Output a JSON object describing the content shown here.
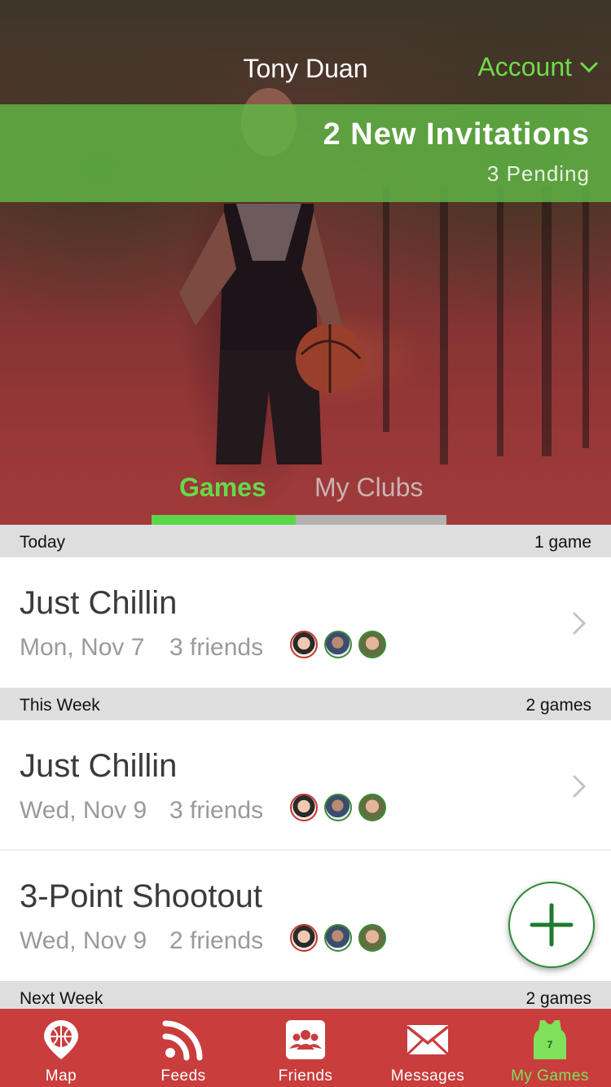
{
  "header": {
    "user_name": "Tony Duan",
    "account_label": "Account"
  },
  "invitations": {
    "title": "2 New Invitations",
    "pending": "3 Pending"
  },
  "tabs": [
    {
      "label": "Games",
      "active": true
    },
    {
      "label": "My Clubs",
      "active": false
    }
  ],
  "sections": [
    {
      "label": "Today",
      "count": "1 game",
      "games": [
        {
          "title": "Just Chillin",
          "date": "Mon, Nov 7",
          "friends": "3 friends"
        }
      ]
    },
    {
      "label": "This Week",
      "count": "2 games",
      "games": [
        {
          "title": "Just Chillin",
          "date": "Wed, Nov 9",
          "friends": "3 friends"
        },
        {
          "title": "3-Point Shootout",
          "date": "Wed, Nov 9",
          "friends": "2 friends"
        }
      ]
    },
    {
      "label": "Next Week",
      "count": "2 games",
      "games": []
    }
  ],
  "tabbar": [
    {
      "label": "Map",
      "icon": "basketball-pin-icon",
      "active": false
    },
    {
      "label": "Feeds",
      "icon": "rss-feed-icon",
      "active": false
    },
    {
      "label": "Friends",
      "icon": "friends-group-icon",
      "active": false
    },
    {
      "label": "Messages",
      "icon": "envelope-icon",
      "active": false
    },
    {
      "label": "My Games",
      "icon": "jersey-icon",
      "active": true
    }
  ],
  "colors": {
    "accent_green": "#66d94a",
    "tabbar_red": "#c93d3d",
    "section_gray": "#dedede"
  }
}
